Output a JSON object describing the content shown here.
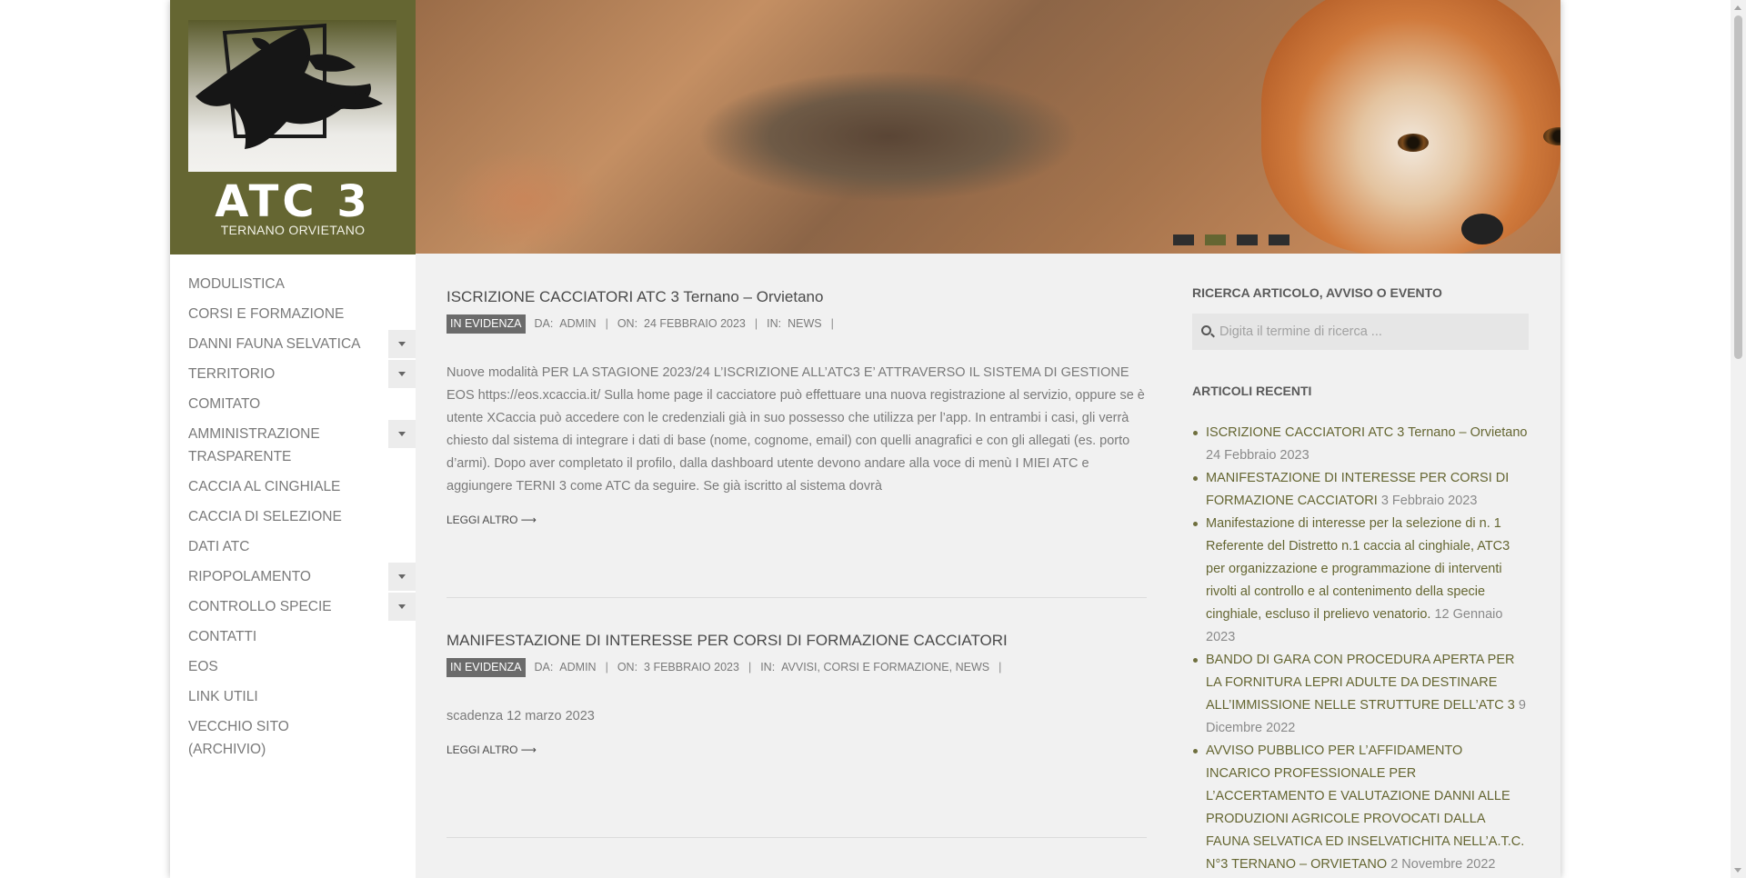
{
  "brand": {
    "title": "ATC 3",
    "subtitle": "TERNANO ORVIETANO",
    "color": "#656632"
  },
  "nav": [
    {
      "label": "MODULISTICA",
      "submenu": false
    },
    {
      "label": "CORSI E FORMAZIONE",
      "submenu": false
    },
    {
      "label": "DANNI FAUNA SELVATICA",
      "submenu": true
    },
    {
      "label": "TERRITORIO",
      "submenu": true
    },
    {
      "label": "COMITATO",
      "submenu": false
    },
    {
      "label": "AMMINISTRAZIONE TRASPARENTE",
      "submenu": true
    },
    {
      "label": "CACCIA AL CINGHIALE",
      "submenu": false
    },
    {
      "label": "CACCIA DI SELEZIONE",
      "submenu": false
    },
    {
      "label": "DATI ATC",
      "submenu": false
    },
    {
      "label": "RIPOPOLAMENTO",
      "submenu": true
    },
    {
      "label": "CONTROLLO SPECIE",
      "submenu": true
    },
    {
      "label": "CONTATTI",
      "submenu": false
    },
    {
      "label": "EOS",
      "submenu": false
    },
    {
      "label": "LINK UTILI",
      "submenu": false
    },
    {
      "label": "VECCHIO SITO (ARCHIVIO)",
      "submenu": false
    }
  ],
  "slider": {
    "active_index": 1,
    "dot_count": 4
  },
  "posts": [
    {
      "title": "ISCRIZIONE CACCIATORI ATC 3 Ternano – Orvietano",
      "badge": "IN EVIDENZA",
      "author_label": "DA:",
      "author": "ADMIN",
      "date_label": "ON:",
      "date": "24 FEBBRAIO 2023",
      "cat_label": "IN:",
      "categories": "NEWS",
      "excerpt": "Nuove modalità PER LA STAGIONE 2023/24 L’ISCRIZIONE ALL’ATC3 E’ ATTRAVERSO IL SISTEMA DI GESTIONE EOS https://eos.xcaccia.it/ Sulla home page il cacciatore può effettuare una nuova registrazione al servizio, oppure se è utente XCaccia può accedere con le credenziali già in suo possesso che utilizza per l’app. In entrambi i casi, gli verrà chiesto dal sistema di integrare i dati di base (nome, cognome, email) con quelli anagrafici e con gli allegati (es. porto d’armi). Dopo aver completato il profilo, dalla dashboard utente devono andare alla voce di menù I MIEI ATC e aggiungere TERNI 3 come ATC da seguire. Se già iscritto al sistema dovrà",
      "readmore": "LEGGI ALTRO ⟶"
    },
    {
      "title": "MANIFESTAZIONE DI INTERESSE PER CORSI DI FORMAZIONE CACCIATORI",
      "badge": "IN EVIDENZA",
      "author_label": "DA:",
      "author": "ADMIN",
      "date_label": "ON:",
      "date": "3 FEBBRAIO 2023",
      "cat_label": "IN:",
      "categories": "AVVISI, CORSI E FORMAZIONE, NEWS",
      "excerpt": "scadenza 12 marzo 2023",
      "readmore": "LEGGI ALTRO ⟶"
    }
  ],
  "widgets": {
    "search_title": "RICERCA ARTICOLO, AVVISO O EVENTO",
    "search_placeholder": "Digita il termine di ricerca ...",
    "recent_title": "ARTICOLI RECENTI",
    "recent": [
      {
        "link": "ISCRIZIONE CACCIATORI ATC 3 Ternano – Orvietano",
        "date": "24 Febbraio 2023"
      },
      {
        "link": "MANIFESTAZIONE DI INTERESSE PER CORSI DI FORMAZIONE CACCIATORI",
        "date": "3 Febbraio 2023"
      },
      {
        "link": "Manifestazione di interesse per la selezione di n. 1 Referente del Distretto n.1 caccia al cinghiale, ATC3 per organizzazione e programmazione di interventi rivolti al controllo e al contenimento della specie cinghiale, escluso il prelievo venatorio.",
        "date": "12 Gennaio 2023"
      },
      {
        "link": "BANDO DI GARA CON PROCEDURA APERTA PER LA FORNITURA LEPRI ADULTE DA DESTINARE ALL’IMMISSIONE NELLE STRUTTURE DELL’ATC 3",
        "date": "9 Dicembre 2022"
      },
      {
        "link": "AVVISO PUBBLICO PER L’AFFIDAMENTO INCARICO PROFESSIONALE PER L’ACCERTAMENTO E VALUTAZIONE DANNI ALLE PRODUZIONI AGRICOLE PROVOCATI DALLA FAUNA SELVATICA ED INSELVATICHITA NELL’A.T.C. N°3 TERNANO – ORVIETANO",
        "date": "2 Novembre 2022"
      }
    ]
  }
}
